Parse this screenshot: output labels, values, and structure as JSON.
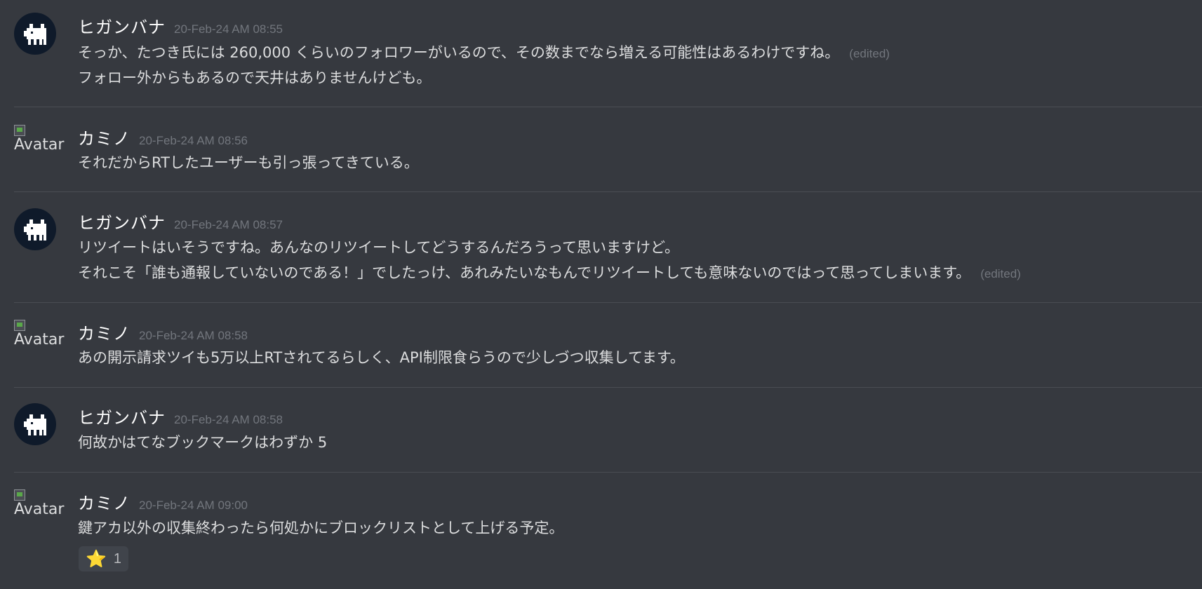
{
  "messages": [
    {
      "author": "ヒガンバナ",
      "timestamp": "20-Feb-24 AM 08:55",
      "avatar": "pixel-animal-icon",
      "lines": [
        "そっか、たつき氏には 260,000 くらいのフォロワーがいるので、その数までなら増える可能性はあるわけですね。",
        "フォロー外からもあるので天井はありませんけども。"
      ],
      "edited": "(edited)"
    },
    {
      "author": "カミノ",
      "timestamp": "20-Feb-24 AM 08:56",
      "avatar_alt": "Avatar",
      "lines": [
        "それだからRTしたユーザーも引っ張ってきている。"
      ]
    },
    {
      "author": "ヒガンバナ",
      "timestamp": "20-Feb-24 AM 08:57",
      "avatar": "pixel-animal-icon",
      "lines": [
        "リツイートはいそうですね。あんなのリツイートしてどうするんだろうって思いますけど。",
        "それこそ「誰も通報していないのである！」でしたっけ、あれみたいなもんでリツイートしても意味ないのではって思ってしまいます。"
      ],
      "edited": "(edited)"
    },
    {
      "author": "カミノ",
      "timestamp": "20-Feb-24 AM 08:58",
      "avatar_alt": "Avatar",
      "lines": [
        "あの開示請求ツイも5万以上RTされてるらしく、API制限食らうので少しづつ収集してます。"
      ]
    },
    {
      "author": "ヒガンバナ",
      "timestamp": "20-Feb-24 AM 08:58",
      "avatar": "pixel-animal-icon",
      "lines": [
        "何故かはてなブックマークはわずか 5"
      ]
    },
    {
      "author": "カミノ",
      "timestamp": "20-Feb-24 AM 09:00",
      "avatar_alt": "Avatar",
      "lines": [
        "鍵アカ以外の収集終わったら何処かにブロックリストとして上げる予定。"
      ],
      "reaction": {
        "emoji": "⭐",
        "count": "1"
      }
    }
  ]
}
